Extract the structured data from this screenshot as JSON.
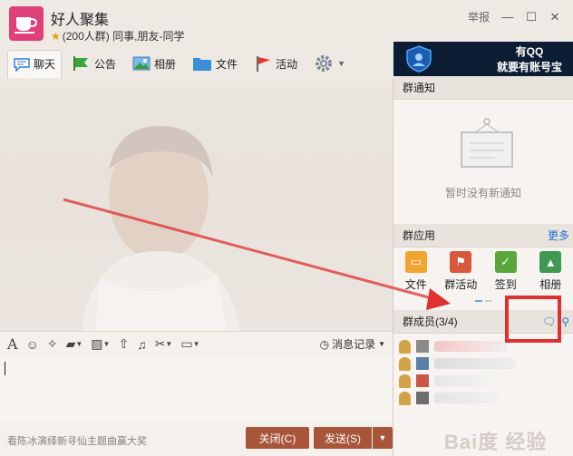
{
  "window": {
    "title": "好人聚集",
    "subtitle": "(200人群) 同事,朋友-同学",
    "report_label": "举报"
  },
  "toolbar": {
    "tabs": [
      {
        "label": "聊天"
      },
      {
        "label": "公告"
      },
      {
        "label": "相册"
      },
      {
        "label": "文件"
      },
      {
        "label": "活动"
      }
    ]
  },
  "ad": {
    "line1": "有QQ",
    "line2": "就要有账号宝"
  },
  "input_toolbar": {
    "record_label": "消息记录"
  },
  "bottom": {
    "ticker": "看陈冰演绎新寻仙主题曲赢大奖",
    "close_label": "关闭(C)",
    "send_label": "发送(S)"
  },
  "panel": {
    "notice_title": "群通知",
    "notice_empty": "暂时没有新通知",
    "apps_title": "群应用",
    "more_label": "更多",
    "apps": [
      {
        "label": "文件",
        "color": "#f2a431"
      },
      {
        "label": "群活动",
        "color": "#d9573b"
      },
      {
        "label": "签到",
        "color": "#59a63a"
      },
      {
        "label": "相册",
        "color": "#3e9a52"
      }
    ],
    "members_title": "群成员(3/4)"
  },
  "watermark": "Bai度 经验",
  "colors": {
    "accent": "#a8553a",
    "highlight": "#e03030",
    "link": "#1d6fcc"
  }
}
